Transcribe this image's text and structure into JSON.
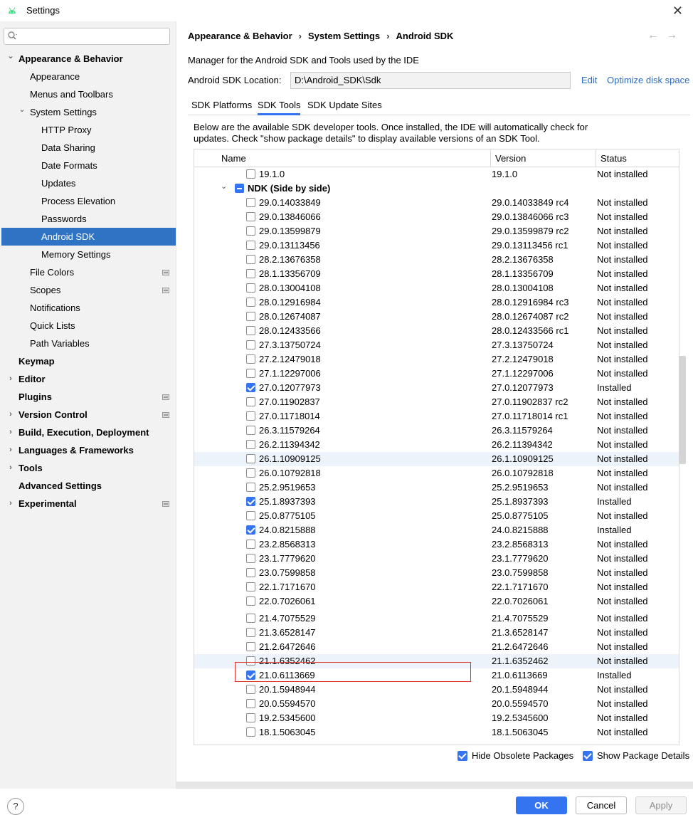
{
  "window": {
    "title": "Settings",
    "close_glyph": "✕",
    "icon": "android-icon"
  },
  "search": {
    "placeholder": "",
    "value": "",
    "icon": "search-icon"
  },
  "sidebar": {
    "items": [
      {
        "label": "Appearance & Behavior",
        "bold": true,
        "expanded": true,
        "level": 0
      },
      {
        "label": "Appearance",
        "level": 1
      },
      {
        "label": "Menus and Toolbars",
        "level": 1
      },
      {
        "label": "System Settings",
        "level": 1,
        "expanded": true
      },
      {
        "label": "HTTP Proxy",
        "level": 2
      },
      {
        "label": "Data Sharing",
        "level": 2
      },
      {
        "label": "Date Formats",
        "level": 2
      },
      {
        "label": "Updates",
        "level": 2
      },
      {
        "label": "Process Elevation",
        "level": 2
      },
      {
        "label": "Passwords",
        "level": 2
      },
      {
        "label": "Android SDK",
        "level": 2,
        "selected": true
      },
      {
        "label": "Memory Settings",
        "level": 2
      },
      {
        "label": "File Colors",
        "level": 1,
        "project": true
      },
      {
        "label": "Scopes",
        "level": 1,
        "project": true
      },
      {
        "label": "Notifications",
        "level": 1
      },
      {
        "label": "Quick Lists",
        "level": 1
      },
      {
        "label": "Path Variables",
        "level": 1
      },
      {
        "label": "Keymap",
        "bold": true,
        "level": 0
      },
      {
        "label": "Editor",
        "bold": true,
        "level": 0,
        "collapsed": true
      },
      {
        "label": "Plugins",
        "bold": true,
        "level": 0,
        "project": true
      },
      {
        "label": "Version Control",
        "bold": true,
        "level": 0,
        "collapsed": true,
        "project": true
      },
      {
        "label": "Build, Execution, Deployment",
        "bold": true,
        "level": 0,
        "collapsed": true
      },
      {
        "label": "Languages & Frameworks",
        "bold": true,
        "level": 0,
        "collapsed": true
      },
      {
        "label": "Tools",
        "bold": true,
        "level": 0,
        "collapsed": true
      },
      {
        "label": "Advanced Settings",
        "bold": true,
        "level": 0
      },
      {
        "label": "Experimental",
        "bold": true,
        "level": 0,
        "collapsed": true,
        "project": true
      }
    ]
  },
  "header": {
    "breadcrumb": [
      "Appearance & Behavior",
      "System Settings",
      "Android SDK"
    ],
    "separator": "›",
    "back_glyph": "←",
    "forward_glyph": "→"
  },
  "main": {
    "description": "Manager for the Android SDK and Tools used by the IDE",
    "location_label": "Android SDK Location:",
    "location_value": "D:\\Android_SDK\\Sdk",
    "edit_link": "Edit",
    "optimize_link": "Optimize disk space",
    "tabs": [
      {
        "label": "SDK Platforms",
        "active": false
      },
      {
        "label": "SDK Tools",
        "active": true
      },
      {
        "label": "SDK Update Sites",
        "active": false
      }
    ],
    "info_line1": "Below are the available SDK developer tools. Once installed, the IDE will automatically check for",
    "info_line2": "updates. Check \"show package details\" to display available versions of an SDK Tool."
  },
  "table": {
    "columns": [
      "Name",
      "Version",
      "Status"
    ],
    "rows": [
      {
        "name": "19.1.0",
        "version": "19.1.0",
        "status": "Not installed",
        "checked": false
      },
      {
        "name": "NDK (Side by side)",
        "group": true,
        "chevron": "⌄"
      },
      {
        "name": "29.0.14033849",
        "version": "29.0.14033849 rc4",
        "status": "Not installed",
        "checked": false
      },
      {
        "name": "29.0.13846066",
        "version": "29.0.13846066 rc3",
        "status": "Not installed",
        "checked": false
      },
      {
        "name": "29.0.13599879",
        "version": "29.0.13599879 rc2",
        "status": "Not installed",
        "checked": false
      },
      {
        "name": "29.0.13113456",
        "version": "29.0.13113456 rc1",
        "status": "Not installed",
        "checked": false
      },
      {
        "name": "28.2.13676358",
        "version": "28.2.13676358",
        "status": "Not installed",
        "checked": false
      },
      {
        "name": "28.1.13356709",
        "version": "28.1.13356709",
        "status": "Not installed",
        "checked": false
      },
      {
        "name": "28.0.13004108",
        "version": "28.0.13004108",
        "status": "Not installed",
        "checked": false
      },
      {
        "name": "28.0.12916984",
        "version": "28.0.12916984 rc3",
        "status": "Not installed",
        "checked": false
      },
      {
        "name": "28.0.12674087",
        "version": "28.0.12674087 rc2",
        "status": "Not installed",
        "checked": false
      },
      {
        "name": "28.0.12433566",
        "version": "28.0.12433566 rc1",
        "status": "Not installed",
        "checked": false
      },
      {
        "name": "27.3.13750724",
        "version": "27.3.13750724",
        "status": "Not installed",
        "checked": false
      },
      {
        "name": "27.2.12479018",
        "version": "27.2.12479018",
        "status": "Not installed",
        "checked": false
      },
      {
        "name": "27.1.12297006",
        "version": "27.1.12297006",
        "status": "Not installed",
        "checked": false
      },
      {
        "name": "27.0.12077973",
        "version": "27.0.12077973",
        "status": "Installed",
        "checked": true
      },
      {
        "name": "27.0.11902837",
        "version": "27.0.11902837 rc2",
        "status": "Not installed",
        "checked": false
      },
      {
        "name": "27.0.11718014",
        "version": "27.0.11718014 rc1",
        "status": "Not installed",
        "checked": false
      },
      {
        "name": "26.3.11579264",
        "version": "26.3.11579264",
        "status": "Not installed",
        "checked": false
      },
      {
        "name": "26.2.11394342",
        "version": "26.2.11394342",
        "status": "Not installed",
        "checked": false
      },
      {
        "name": "26.1.10909125",
        "version": "26.1.10909125",
        "status": "Not installed",
        "checked": false,
        "highlight": true
      },
      {
        "name": "26.0.10792818",
        "version": "26.0.10792818",
        "status": "Not installed",
        "checked": false
      },
      {
        "name": "25.2.9519653",
        "version": "25.2.9519653",
        "status": "Not installed",
        "checked": false
      },
      {
        "name": "25.1.8937393",
        "version": "25.1.8937393",
        "status": "Installed",
        "checked": true
      },
      {
        "name": "25.0.8775105",
        "version": "25.0.8775105",
        "status": "Not installed",
        "checked": false
      },
      {
        "name": "24.0.8215888",
        "version": "24.0.8215888",
        "status": "Installed",
        "checked": true
      },
      {
        "name": "23.2.8568313",
        "version": "23.2.8568313",
        "status": "Not installed",
        "checked": false
      },
      {
        "name": "23.1.7779620",
        "version": "23.1.7779620",
        "status": "Not installed",
        "checked": false
      },
      {
        "name": "23.0.7599858",
        "version": "23.0.7599858",
        "status": "Not installed",
        "checked": false
      },
      {
        "name": "22.1.7171670",
        "version": "22.1.7171670",
        "status": "Not installed",
        "checked": false
      },
      {
        "name": "22.0.7026061",
        "version": "22.0.7026061",
        "status": "Not installed",
        "checked": false
      },
      {
        "name": "21.4.7075529",
        "version": "21.4.7075529",
        "status": "Not installed",
        "checked": false,
        "gap": true
      },
      {
        "name": "21.3.6528147",
        "version": "21.3.6528147",
        "status": "Not installed",
        "checked": false
      },
      {
        "name": "21.2.6472646",
        "version": "21.2.6472646",
        "status": "Not installed",
        "checked": false
      },
      {
        "name": "21.1.6352462",
        "version": "21.1.6352462",
        "status": "Not installed",
        "checked": false,
        "highlight": true
      },
      {
        "name": "21.0.6113669",
        "version": "21.0.6113669",
        "status": "Installed",
        "checked": true
      },
      {
        "name": "20.1.5948944",
        "version": "20.1.5948944",
        "status": "Not installed",
        "checked": false
      },
      {
        "name": "20.0.5594570",
        "version": "20.0.5594570",
        "status": "Not installed",
        "checked": false
      },
      {
        "name": "19.2.5345600",
        "version": "19.2.5345600",
        "status": "Not installed",
        "checked": false
      },
      {
        "name": "18.1.5063045",
        "version": "18.1.5063045",
        "status": "Not installed",
        "checked": false
      }
    ]
  },
  "options": {
    "hide_obsolete": {
      "label": "Hide Obsolete Packages",
      "checked": true
    },
    "show_details": {
      "label": "Show Package Details",
      "checked": true
    }
  },
  "footer": {
    "help": "?",
    "ok": "OK",
    "cancel": "Cancel",
    "apply": "Apply"
  },
  "colors": {
    "accent": "#3574f0",
    "selected": "#2f73c5",
    "link": "#2b6bc0",
    "highlight_box": "#e0312f"
  }
}
